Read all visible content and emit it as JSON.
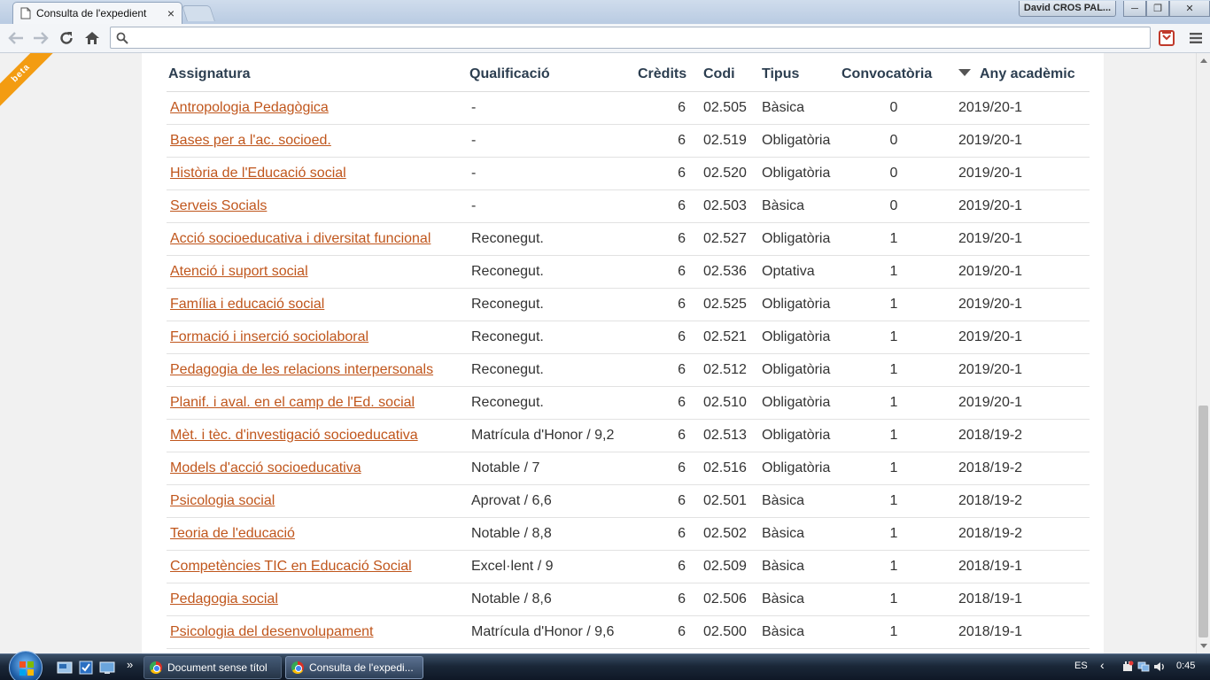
{
  "browser": {
    "tab_title": "Consulta de l'expedient",
    "tab_close": "×",
    "user_name": "David CROS PAL...",
    "window_controls": {
      "minimize": "─",
      "restore": "❐",
      "close": "✕"
    },
    "address_value": "",
    "address_placeholder": ""
  },
  "page": {
    "ribbon": "beta",
    "table": {
      "headers": {
        "subject": "Assignatura",
        "grade": "Qualificació",
        "credits": "Crèdits",
        "code": "Codi",
        "type": "Tipus",
        "sitting": "Convocatòria",
        "year": "Any acadèmic"
      },
      "rows": [
        {
          "subject": "Antropologia Pedagògica",
          "grade": "-",
          "credits": "6",
          "code": "02.505",
          "type": "Bàsica",
          "sitting": "0",
          "year": "2019/20-1"
        },
        {
          "subject": "Bases per a l'ac. socioed.",
          "grade": "-",
          "credits": "6",
          "code": "02.519",
          "type": "Obligatòria",
          "sitting": "0",
          "year": "2019/20-1"
        },
        {
          "subject": "Història de l'Educació social",
          "grade": "-",
          "credits": "6",
          "code": "02.520",
          "type": "Obligatòria",
          "sitting": "0",
          "year": "2019/20-1"
        },
        {
          "subject": "Serveis Socials",
          "grade": "-",
          "credits": "6",
          "code": "02.503",
          "type": "Bàsica",
          "sitting": "0",
          "year": "2019/20-1"
        },
        {
          "subject": "Acció socioeducativa i diversitat funcional",
          "grade": "Reconegut.",
          "credits": "6",
          "code": "02.527",
          "type": "Obligatòria",
          "sitting": "1",
          "year": "2019/20-1"
        },
        {
          "subject": "Atenció i suport social",
          "grade": "Reconegut.",
          "credits": "6",
          "code": "02.536",
          "type": "Optativa",
          "sitting": "1",
          "year": "2019/20-1"
        },
        {
          "subject": "Família i educació social",
          "grade": "Reconegut.",
          "credits": "6",
          "code": "02.525",
          "type": "Obligatòria",
          "sitting": "1",
          "year": "2019/20-1"
        },
        {
          "subject": "Formació i inserció sociolaboral",
          "grade": "Reconegut.",
          "credits": "6",
          "code": "02.521",
          "type": "Obligatòria",
          "sitting": "1",
          "year": "2019/20-1"
        },
        {
          "subject": "Pedagogia de les relacions interpersonals",
          "grade": "Reconegut.",
          "credits": "6",
          "code": "02.512",
          "type": "Obligatòria",
          "sitting": "1",
          "year": "2019/20-1"
        },
        {
          "subject": "Planif. i aval. en el camp de l'Ed. social",
          "grade": "Reconegut.",
          "credits": "6",
          "code": "02.510",
          "type": "Obligatòria",
          "sitting": "1",
          "year": "2019/20-1"
        },
        {
          "subject": "Mèt. i tèc. d'investigació socioeducativa",
          "grade": "Matrícula d'Honor / 9,2",
          "credits": "6",
          "code": "02.513",
          "type": "Obligatòria",
          "sitting": "1",
          "year": "2018/19-2"
        },
        {
          "subject": "Models d'acció socioeducativa",
          "grade": "Notable / 7",
          "credits": "6",
          "code": "02.516",
          "type": "Obligatòria",
          "sitting": "1",
          "year": "2018/19-2"
        },
        {
          "subject": "Psicologia social",
          "grade": "Aprovat / 6,6",
          "credits": "6",
          "code": "02.501",
          "type": "Bàsica",
          "sitting": "1",
          "year": "2018/19-2"
        },
        {
          "subject": "Teoria de l'educació",
          "grade": "Notable / 8,8",
          "credits": "6",
          "code": "02.502",
          "type": "Bàsica",
          "sitting": "1",
          "year": "2018/19-2"
        },
        {
          "subject": "Competències TIC en Educació Social",
          "grade": "Excel·lent / 9",
          "credits": "6",
          "code": "02.509",
          "type": "Bàsica",
          "sitting": "1",
          "year": "2018/19-1"
        },
        {
          "subject": "Pedagogia social",
          "grade": "Notable / 8,6",
          "credits": "6",
          "code": "02.506",
          "type": "Bàsica",
          "sitting": "1",
          "year": "2018/19-1"
        },
        {
          "subject": "Psicologia del desenvolupament",
          "grade": "Matrícula d'Honor / 9,6",
          "credits": "6",
          "code": "02.500",
          "type": "Bàsica",
          "sitting": "1",
          "year": "2018/19-1"
        }
      ]
    }
  },
  "taskbar": {
    "more": "»",
    "buttons": [
      {
        "label": "Document sense títol",
        "active": false
      },
      {
        "label": "Consulta de l'expedi...",
        "active": true
      }
    ],
    "language": "ES",
    "tray_arrow": "‹",
    "clock": "0:45"
  },
  "colors": {
    "link": "#c0561c",
    "header_text": "#2c3e50",
    "ribbon": "#f39c12"
  }
}
